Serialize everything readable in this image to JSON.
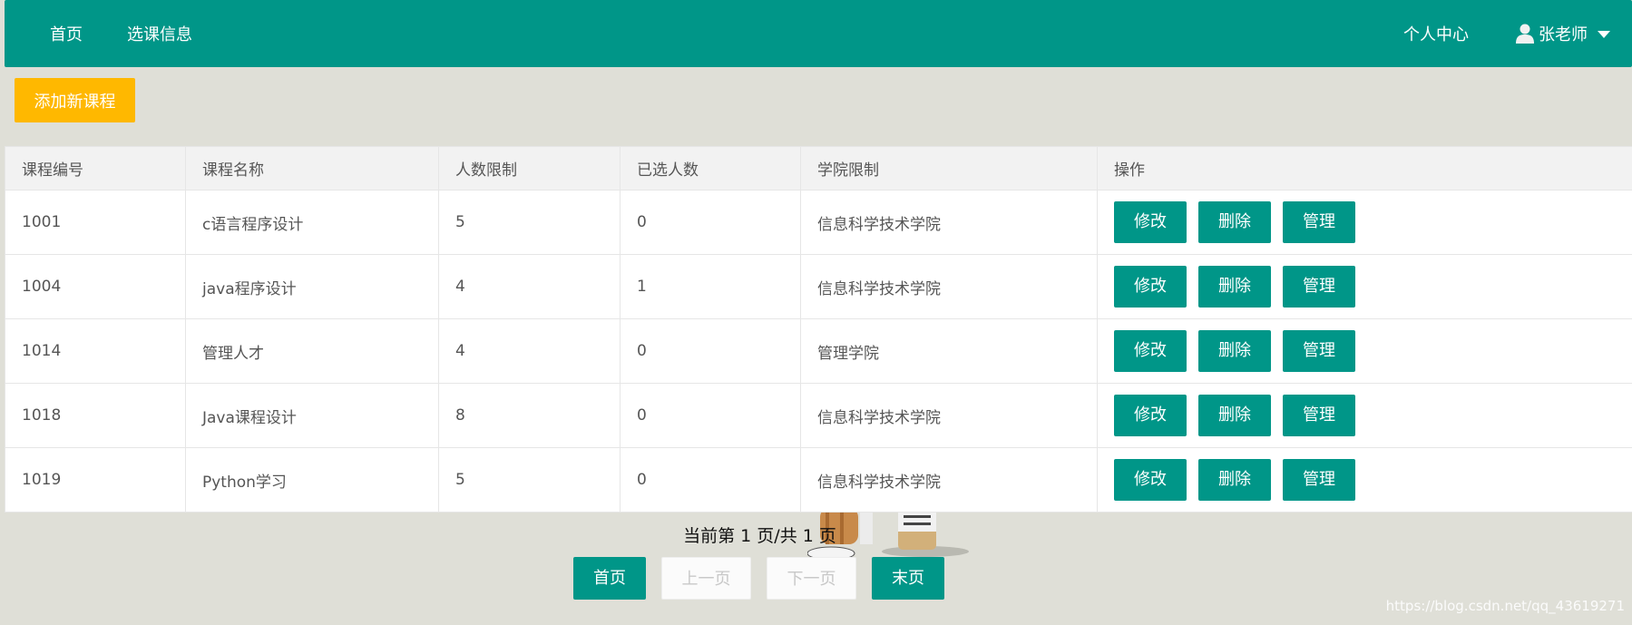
{
  "nav": {
    "home": "首页",
    "course_info": "选课信息",
    "profile": "个人中心",
    "user_name": "张老师"
  },
  "toolbar": {
    "add_course": "添加新课程"
  },
  "table": {
    "headers": [
      "课程编号",
      "课程名称",
      "人数限制",
      "已选人数",
      "学院限制",
      "操作"
    ],
    "rows": [
      {
        "id": "1001",
        "name": "c语言程序设计",
        "limit": "5",
        "selected": "0",
        "college": "信息科学技术学院"
      },
      {
        "id": "1004",
        "name": "java程序设计",
        "limit": "4",
        "selected": "1",
        "college": "信息科学技术学院"
      },
      {
        "id": "1014",
        "name": "管理人才",
        "limit": "4",
        "selected": "0",
        "college": "管理学院"
      },
      {
        "id": "1018",
        "name": "Java课程设计",
        "limit": "8",
        "selected": "0",
        "college": "信息科学技术学院"
      },
      {
        "id": "1019",
        "name": "Python学习",
        "limit": "5",
        "selected": "0",
        "college": "信息科学技术学院"
      }
    ],
    "actions": {
      "edit": "修改",
      "delete": "删除",
      "manage": "管理"
    }
  },
  "pagination": {
    "info": "当前第 1 页/共 1 页",
    "first": "首页",
    "prev": "上一页",
    "next": "下一页",
    "last": "末页"
  },
  "watermark": "https://blog.csdn.net/qq_43619271",
  "colors": {
    "primary": "#009688",
    "warning": "#ffb800",
    "background": "#dfdfd7"
  },
  "icons": {
    "user": "user-icon",
    "caret": "caret-down-icon"
  }
}
